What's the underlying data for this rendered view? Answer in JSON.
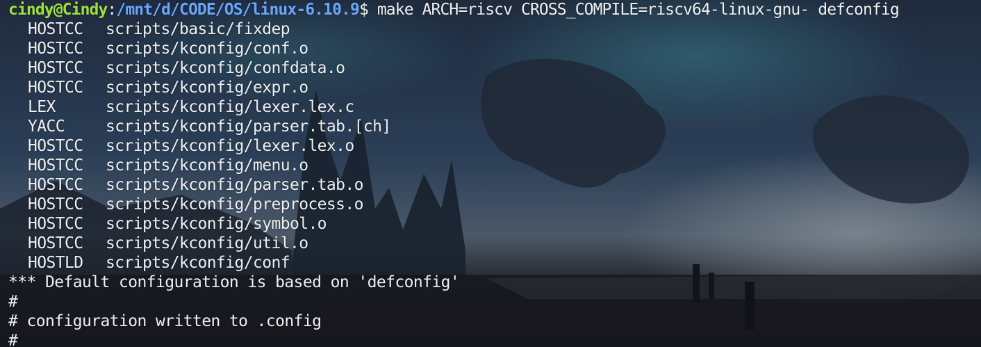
{
  "prompt": {
    "user_host": "cindy@Cindy",
    "separator": ":",
    "path": "/mnt/d/CODE/OS/linux-6.10.9",
    "symbol": "$",
    "command": " make ARCH=riscv CROSS_COMPILE=riscv64-linux-gnu- defconfig"
  },
  "build_lines": [
    {
      "tag": "HOSTCC",
      "file": "scripts/basic/fixdep"
    },
    {
      "tag": "HOSTCC",
      "file": "scripts/kconfig/conf.o"
    },
    {
      "tag": "HOSTCC",
      "file": "scripts/kconfig/confdata.o"
    },
    {
      "tag": "HOSTCC",
      "file": "scripts/kconfig/expr.o"
    },
    {
      "tag": "LEX",
      "file": "scripts/kconfig/lexer.lex.c"
    },
    {
      "tag": "YACC",
      "file": "scripts/kconfig/parser.tab.[ch]"
    },
    {
      "tag": "HOSTCC",
      "file": "scripts/kconfig/lexer.lex.o"
    },
    {
      "tag": "HOSTCC",
      "file": "scripts/kconfig/menu.o"
    },
    {
      "tag": "HOSTCC",
      "file": "scripts/kconfig/parser.tab.o"
    },
    {
      "tag": "HOSTCC",
      "file": "scripts/kconfig/preprocess.o"
    },
    {
      "tag": "HOSTCC",
      "file": "scripts/kconfig/symbol.o"
    },
    {
      "tag": "HOSTCC",
      "file": "scripts/kconfig/util.o"
    },
    {
      "tag": "HOSTLD",
      "file": "scripts/kconfig/conf"
    }
  ],
  "output_lines": [
    "*** Default configuration is based on 'defconfig'",
    "#",
    "# configuration written to .config",
    "#"
  ],
  "colors": {
    "user_host": "#9ee13a",
    "path": "#6aa6ff",
    "text": "#eef1f4",
    "background": "#1b2230"
  }
}
